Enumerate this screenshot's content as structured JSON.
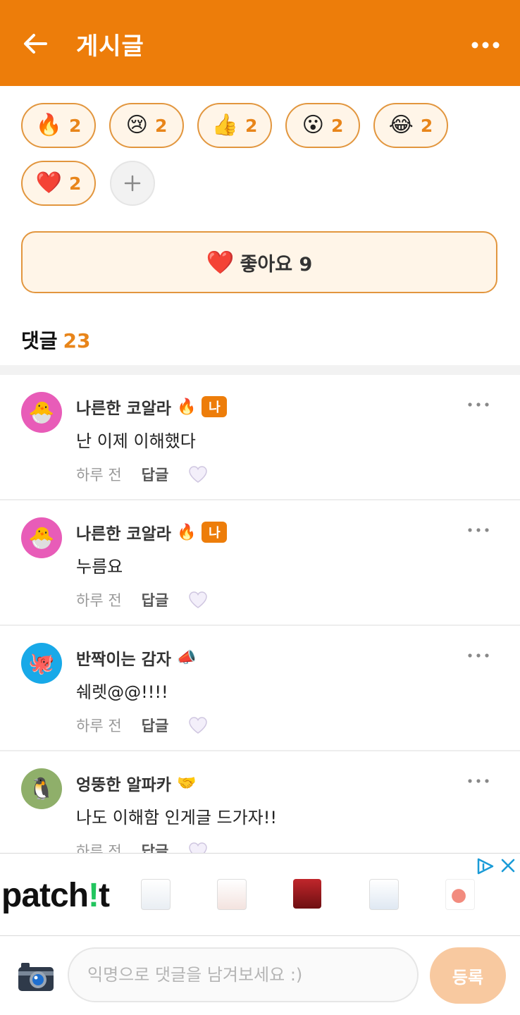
{
  "header": {
    "title": "게시글",
    "back_icon": "arrow-left-icon",
    "more_icon": "more-horizontal-icon",
    "background_color": "#ED7D0A"
  },
  "reactions": [
    {
      "emoji": "🔥",
      "count": "2",
      "icon": "fire-emoji"
    },
    {
      "emoji": "😢",
      "count": "2",
      "icon": "crying-face-emoji"
    },
    {
      "emoji": "👍",
      "count": "2",
      "icon": "thumbs-up-emoji"
    },
    {
      "emoji": "😮",
      "count": "2",
      "icon": "surprised-face-emoji"
    },
    {
      "emoji": "😂",
      "count": "2",
      "icon": "laughing-face-emoji"
    },
    {
      "emoji": "❤️",
      "count": "2",
      "icon": "heart-emoji"
    }
  ],
  "like_button": {
    "emoji": "❤️",
    "label": "좋아요 9"
  },
  "comments_section": {
    "label": "댓글",
    "count": "23"
  },
  "comments": [
    {
      "avatar_emoji": "🐣",
      "avatar_color": "#E85CB8",
      "name": "나른한 코알라",
      "badge_emoji": "🔥",
      "is_me_label": "나",
      "text": "난 이제 이해했다",
      "time": "하루 전",
      "reply_label": "답글"
    },
    {
      "avatar_emoji": "🐣",
      "avatar_color": "#E85CB8",
      "name": "나른한 코알라",
      "badge_emoji": "🔥",
      "is_me_label": "나",
      "text": "누름요",
      "time": "하루 전",
      "reply_label": "답글"
    },
    {
      "avatar_emoji": "🐙",
      "avatar_color": "#18A9E8",
      "name": "반짝이는 감자",
      "badge_emoji": "📣",
      "is_me_label": "",
      "text": "쉐렛@@!!!!",
      "time": "하루 전",
      "reply_label": "답글"
    },
    {
      "avatar_emoji": "🐧",
      "avatar_color": "#8FAF6A",
      "name": "엉뚱한 알파카",
      "badge_emoji": "🤝",
      "is_me_label": "",
      "text": "나도 이해함 인게글 드가자!!",
      "time": "하루 전",
      "reply_label": "답글"
    }
  ],
  "ad": {
    "brand_prefix": "patch",
    "brand_mark": "!",
    "brand_suffix": "t",
    "info_icon": "ad-choices-icon",
    "close_icon": "close-icon"
  },
  "composer": {
    "camera_icon": "camera-icon",
    "placeholder": "익명으로 댓글을 남겨보세요 :)",
    "submit_label": "등록"
  }
}
